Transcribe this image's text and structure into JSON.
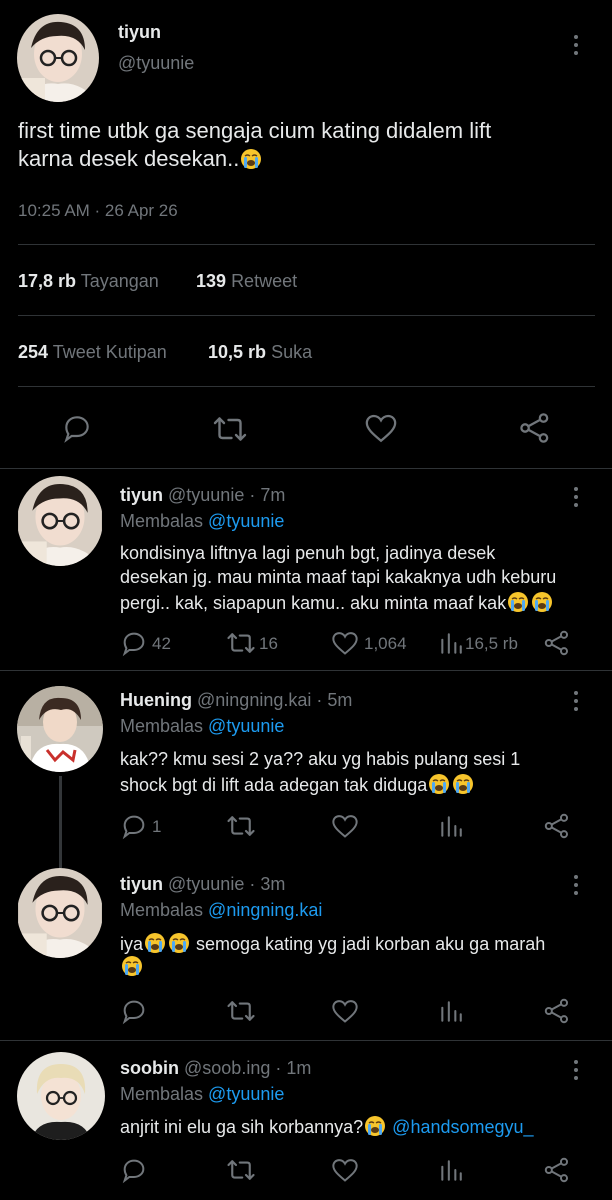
{
  "main_tweet": {
    "display_name": "tiyun",
    "handle": "@tyuunie",
    "text_line1": "first time utbk ga sengaja cium kating didalem lift",
    "text_line2": "karna desek desekan..",
    "timestamp": "10:25 AM · 26 Apr 26",
    "views_count": "17,8 rb",
    "views_label": "Tayangan",
    "retweets_count": "139",
    "retweets_label": "Retweet",
    "quotes_count": "254",
    "quotes_label": "Tweet Kutipan",
    "likes_count": "10,5 rb",
    "likes_label": "Suka"
  },
  "replies": [
    {
      "display_name": "tiyun",
      "handle_time": "@tyuunie · 7m",
      "replying_prefix": "Membalas",
      "replying_to": "@tyuunie",
      "line1": "kondisinya liftnya lagi penuh bgt, jadinya desek",
      "line2": "desekan jg. mau minta maaf tapi kakaknya udh keburu",
      "line3": "pergi.. kak, siapapun kamu.. aku minta maaf kak",
      "reply_count": "42",
      "retweet_count": "16",
      "like_count": "1,064",
      "view_count": "16,5 rb"
    },
    {
      "display_name": "Huening",
      "handle_time": "@ningning.kai · 5m",
      "replying_prefix": "Membalas",
      "replying_to": "@tyuunie",
      "line1": "kak?? kmu sesi 2 ya?? aku yg habis pulang sesi 1",
      "line2": "shock bgt di lift ada adegan tak diduga",
      "reply_count": "1"
    },
    {
      "display_name": "tiyun",
      "handle_time": "@tyuunie · 3m",
      "replying_prefix": "Membalas",
      "replying_to": "@ningning.kai",
      "line1_a": "iya",
      "line1_b": " semoga kating yg jadi korban aku ga marah"
    },
    {
      "display_name": "soobin",
      "handle_time": "@soob.ing · 1m",
      "replying_prefix": "Membalas",
      "replying_to": "@tyuunie",
      "line1": "anjrit ini elu ga sih korbannya?",
      "mention": "@handsomegyu_"
    }
  ],
  "icons": {
    "reply": "reply-bubble-icon",
    "retweet": "retweet-icon",
    "like": "heart-icon",
    "views": "views-bar-chart-icon",
    "share": "share-icon",
    "more": "more-vertical-icon",
    "emoji": "loudly-crying-face-emoji"
  },
  "colors": {
    "background": "#000000",
    "text": "#e7e9ea",
    "muted": "#71767b",
    "link": "#1d9bf0",
    "divider": "#2f3336"
  }
}
